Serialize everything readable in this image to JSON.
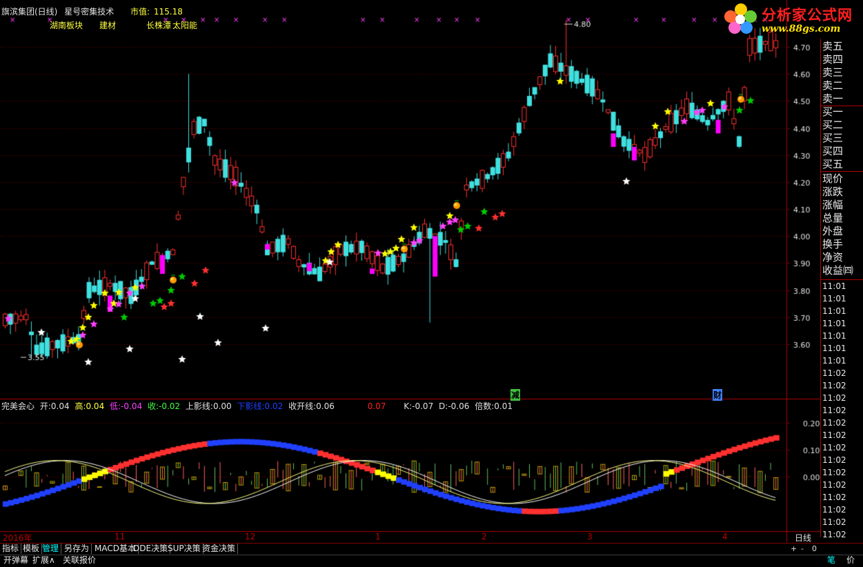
{
  "header": {
    "stock": "旗滨集团(日线)",
    "formula": "星号密集技术",
    "mcap_label": "市值:",
    "mcap_value": "115.18"
  },
  "sectors": [
    "湖南板块",
    "建材",
    "长株潭",
    "太阳能"
  ],
  "logo": {
    "title": "分析家公式网",
    "url": "www.88gs.com"
  },
  "price_axis": {
    "labels": [
      "4.70",
      "4.60",
      "4.50",
      "4.40",
      "4.30",
      "4.20",
      "4.10",
      "4.00",
      "3.90",
      "3.80",
      "3.70",
      "3.60"
    ]
  },
  "indicator_axis": {
    "labels": [
      "0.20",
      "0.10",
      "0.00"
    ]
  },
  "markers": {
    "high": "4.80",
    "low": "3.55"
  },
  "events": [
    {
      "text": "减",
      "color": "#40c040"
    },
    {
      "text": "财",
      "color": "#4080ff"
    }
  ],
  "order_book": [
    "卖五",
    "卖四",
    "卖三",
    "卖二",
    "卖一",
    "买一",
    "买二",
    "买三",
    "买四",
    "买五"
  ],
  "quote_fields": [
    "现价",
    "涨跌",
    "涨幅",
    "总量",
    "外盘",
    "换手",
    "净资",
    "收益㈣"
  ],
  "times": [
    "11:01",
    "11:01",
    "11:01",
    "11:01",
    "11:01",
    "11:01",
    "11:01",
    "11:02",
    "11:02",
    "11:02",
    "11:02",
    "11:02",
    "11:02",
    "11:02",
    "11:02",
    "11:02",
    "11:02",
    "11:02",
    "11:02",
    "11:02",
    "11:02",
    "11:02",
    "11:02"
  ],
  "indicator": {
    "name": "完美会心",
    "open_label": "开:",
    "open": "0.04",
    "high_label": "高:",
    "high": "0.04",
    "low_label": "低:",
    "low": "-0.04",
    "close_label": "收:",
    "close": "-0.02",
    "upper_label": "上影线:",
    "upper": "0.00",
    "lower_label": "下影线:",
    "lower": "0.02",
    "openline_label": "收开线:",
    "openline": "0.06",
    "red_value": "0.07",
    "k_label": "K:",
    "k": "-0.07",
    "d_label": "D:",
    "d": "-0.06",
    "mult_label": "倍数:",
    "mult": "0.01"
  },
  "x_axis": {
    "labels": [
      "2016年",
      "11",
      "12",
      "1",
      "2",
      "3",
      "4"
    ],
    "period": "日线"
  },
  "tabs": [
    "指标",
    "模板",
    "管理",
    "另存为",
    "MACD基本",
    "DDE决策",
    "SUP决策",
    "资金决策"
  ],
  "active_tab": "管理",
  "zoom_controls": [
    "+",
    "-",
    "0"
  ],
  "bottom_buttons": [
    "开弹幕",
    "扩展∧",
    "关联报价"
  ],
  "bottom_right": [
    "笔",
    "价"
  ],
  "colors": {
    "up": "#ff3030",
    "down": "#40e0e0",
    "magenta": "#ff00ff",
    "grid": "#800000",
    "accent_red": "#ff0000",
    "star_yellow": "#ffff00",
    "star_green": "#00cc00",
    "star_white": "#ffffff",
    "star_pink": "#ff40ff"
  }
}
